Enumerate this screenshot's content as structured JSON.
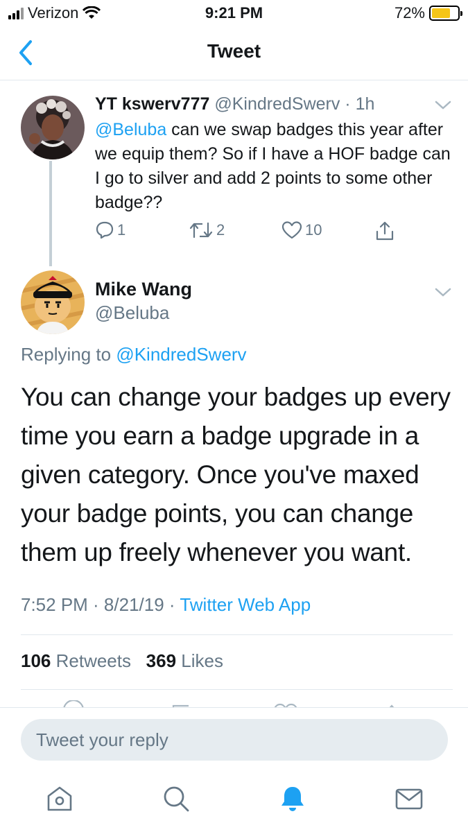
{
  "status_bar": {
    "carrier": "Verizon",
    "time": "9:21 PM",
    "battery_percent": "72%",
    "battery_level": 0.72
  },
  "nav": {
    "title": "Tweet",
    "back_icon": "chevron-left-icon"
  },
  "parent_tweet": {
    "name": "YT kswerv777",
    "handle_time": "@KindredSwerv · 1h",
    "mention": "@Beluba",
    "text": " can we swap badges this year after we equip them? So if I have a HOF badge can I go to silver and add 2 points to some other badge??",
    "replies": "1",
    "retweets": "2",
    "likes": "10"
  },
  "main_tweet": {
    "name": "Mike Wang",
    "handle": "@Beluba",
    "replying_prefix": "Replying to ",
    "replying_to": "@KindredSwerv",
    "text": "You can change your badges up every time you earn a badge upgrade in a given category. Once you've maxed your badge points, you can change them up freely whenever you want.",
    "timestamp": "7:52 PM · 8/21/19 · ",
    "source": "Twitter Web App",
    "retweet_count": "106",
    "retweet_label": " Retweets",
    "like_count": "369",
    "like_label": " Likes"
  },
  "composer": {
    "placeholder": "Tweet your reply"
  },
  "tab_bar": {
    "items": [
      "home-icon",
      "search-icon",
      "notifications-bell-icon",
      "messages-envelope-icon"
    ],
    "active": "notifications-bell-icon"
  },
  "colors": {
    "accent": "#1da1f2",
    "secondary_text": "#657786",
    "border": "#e1e8ed",
    "battery": "#f5c518"
  }
}
